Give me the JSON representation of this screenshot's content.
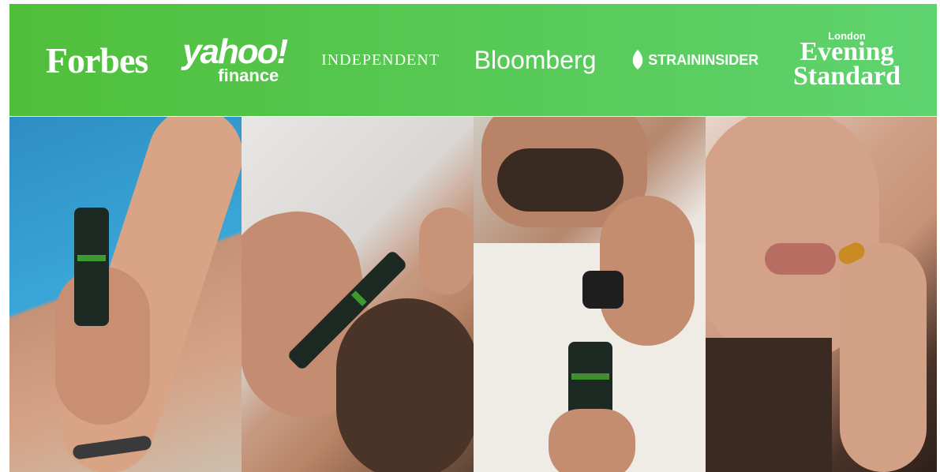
{
  "banner": {
    "background_start": "#4fbf3a",
    "background_end": "#5fd36f",
    "logos": {
      "forbes": "Forbes",
      "yahoo_top": "yahoo!",
      "yahoo_bottom": "finance",
      "independent": "INDEPENDENT",
      "bloomberg": "Bloomberg",
      "straininsider": "STRAININSIDER",
      "evening_small": "London",
      "evening_line1": "Evening",
      "evening_line2": "Standard"
    }
  }
}
